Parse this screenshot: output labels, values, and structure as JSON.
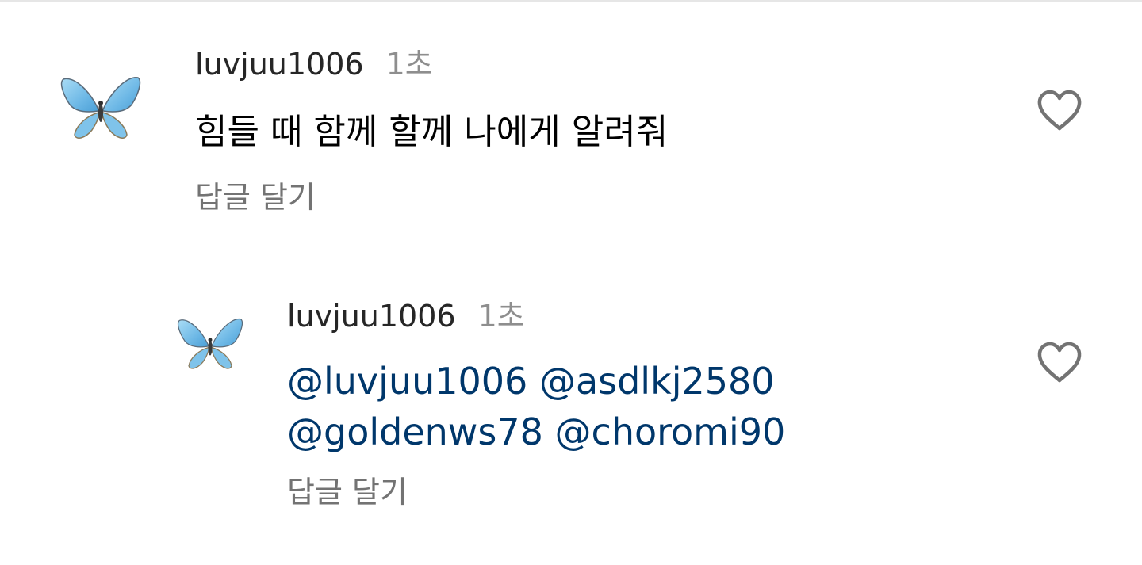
{
  "comments": [
    {
      "username": "luvjuu1006",
      "time": "1초",
      "text": "힘들 때 함께 할께 나에게 알려줘",
      "reply_label": "답글 달기"
    }
  ],
  "replies": [
    {
      "username": "luvjuu1006",
      "time": "1초",
      "mentions": [
        "@luvjuu1006",
        "@asdlkj2580",
        "@goldenws78",
        "@choromi90"
      ],
      "reply_label": "답글 달기"
    }
  ],
  "icons": {
    "avatar": "butterfly-icon",
    "like": "heart-outline-icon"
  },
  "colors": {
    "username": "#262626",
    "timestamp": "#8e8e8e",
    "mention": "#00376b",
    "reply_link": "#737373",
    "heart_outline": "#737373",
    "butterfly_wing": "#7cc4ec"
  }
}
